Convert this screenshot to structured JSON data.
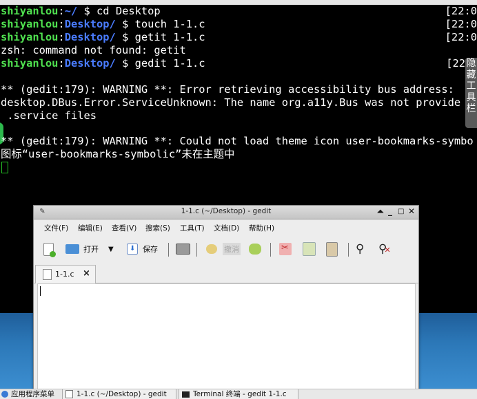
{
  "terminal": {
    "lines": [
      {
        "user": "shiyanlou",
        "sep": ":",
        "path": "~/",
        "rest": " $ cd Desktop",
        "time": "[22:0"
      },
      {
        "user": "shiyanlou",
        "sep": ":",
        "path": "Desktop/",
        "rest": " $ touch 1-1.c",
        "time": "[22:0"
      },
      {
        "user": "shiyanlou",
        "sep": ":",
        "path": "Desktop/",
        "rest": " $ getit 1-1.c",
        "time": "[22:0"
      },
      {
        "plain": "zsh: command not found: getit"
      },
      {
        "user": "shiyanlou",
        "sep": ":",
        "path": "Desktop/",
        "rest": " $ gedit 1-1.c",
        "time": "[22"
      }
    ],
    "warning1": [
      "** (gedit:179): WARNING **: Error retrieving accessibility bus address:",
      "desktop.DBus.Error.ServiceUnknown: The name org.a11y.Bus was not provide",
      " .service files"
    ],
    "warning2": [
      "** (gedit:179): WARNING **: Could not load theme icon user-bookmarks-symbo",
      "图标“user-bookmarks-symbolic”未在主题中"
    ]
  },
  "side_panel": {
    "chars": [
      "隐",
      "藏",
      "工",
      "具",
      "栏"
    ]
  },
  "gedit": {
    "title": "1-1.c (~/Desktop) - gedit",
    "menu": [
      "文件(F)",
      "编辑(E)",
      "查看(V)",
      "搜索(S)",
      "工具(T)",
      "文档(D)",
      "帮助(H)"
    ],
    "toolbar": {
      "open": "打开",
      "save": "保存",
      "revert": "撤消"
    },
    "tab": {
      "label": "1-1.c",
      "close": "×"
    }
  },
  "taskbar": {
    "apps_menu": "应用程序菜单",
    "task1": "1-1.c (~/Desktop) - gedit",
    "task2": "Terminal 终端 - gedit 1-1.c"
  },
  "colors": {
    "terminal_bg": "#000000",
    "prompt_user": "#4fe04f",
    "prompt_path": "#4a7cff"
  }
}
